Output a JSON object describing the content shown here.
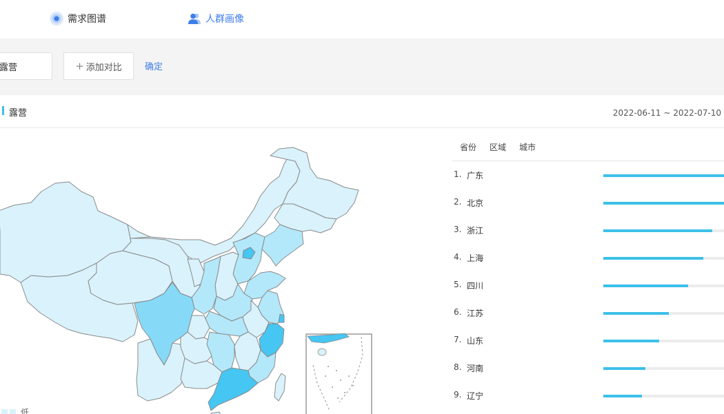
{
  "tabs": [
    {
      "label": "需求图谱",
      "icon": "target-icon",
      "active": false
    },
    {
      "label": "人群画像",
      "icon": "people-icon",
      "active": true
    }
  ],
  "toolbar": {
    "keyword_value": "露营",
    "add_compare_label": "添加对比",
    "confirm_label": "确定"
  },
  "section": {
    "title": "露营",
    "date_range": "2022-06-11 ~ 2022-07-10"
  },
  "rank_tabs": [
    "省份",
    "区域",
    "城市"
  ],
  "ranking": [
    {
      "no": "1.",
      "name": "广东",
      "value": 100
    },
    {
      "no": "2.",
      "name": "北京",
      "value": 100
    },
    {
      "no": "3.",
      "name": "浙江",
      "value": 90
    },
    {
      "no": "4.",
      "name": "上海",
      "value": 83
    },
    {
      "no": "5.",
      "name": "四川",
      "value": 70
    },
    {
      "no": "6.",
      "name": "江苏",
      "value": 54
    },
    {
      "no": "7.",
      "name": "山东",
      "value": 46
    },
    {
      "no": "8.",
      "name": "河南",
      "value": 35
    },
    {
      "no": "9.",
      "name": "辽宁",
      "value": 32
    }
  ],
  "legend": {
    "low_label": "低"
  },
  "colors": {
    "accent": "#3cc0e8",
    "link": "#3f7ee8",
    "map_base": "#d9f2fc",
    "map_light": "#b3e8fa",
    "map_mid": "#86daf8",
    "map_high": "#45c6f3"
  }
}
